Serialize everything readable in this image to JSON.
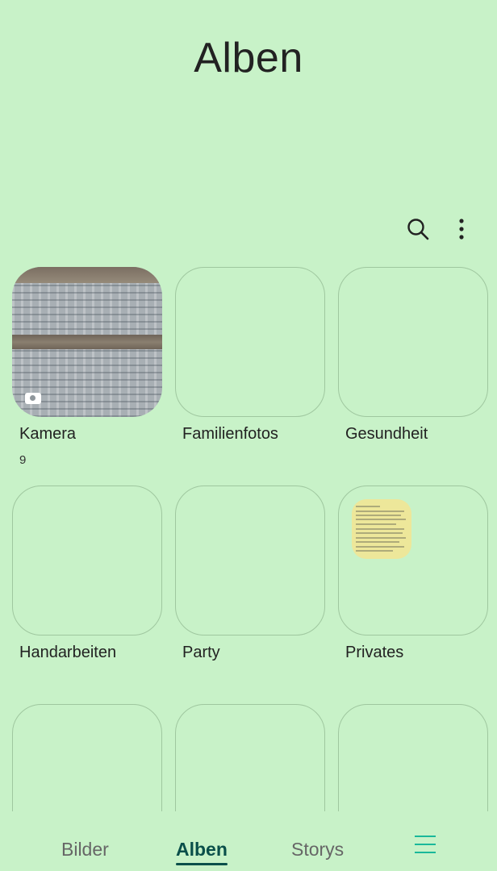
{
  "header": {
    "title": "Alben"
  },
  "toolbar": {
    "search_icon": "search-icon",
    "more_icon": "more-vertical-icon"
  },
  "albums": [
    {
      "label": "Kamera",
      "count": "9"
    },
    {
      "label": "Familienfotos"
    },
    {
      "label": "Gesundheit"
    },
    {
      "label": "Handarbeiten"
    },
    {
      "label": "Party"
    },
    {
      "label": "Privates"
    },
    {
      "label": ""
    },
    {
      "label": ""
    },
    {
      "label": ""
    }
  ],
  "bottom_nav": {
    "tabs": [
      {
        "label": "Bilder"
      },
      {
        "label": "Alben",
        "active": true
      },
      {
        "label": "Storys"
      }
    ],
    "menu_icon": "menu-icon"
  },
  "colors": {
    "background": "#c8f2c8",
    "active_tab": "#0a4f4a",
    "menu_accent": "#1ab89a",
    "tile_border": "#9fc79f"
  }
}
